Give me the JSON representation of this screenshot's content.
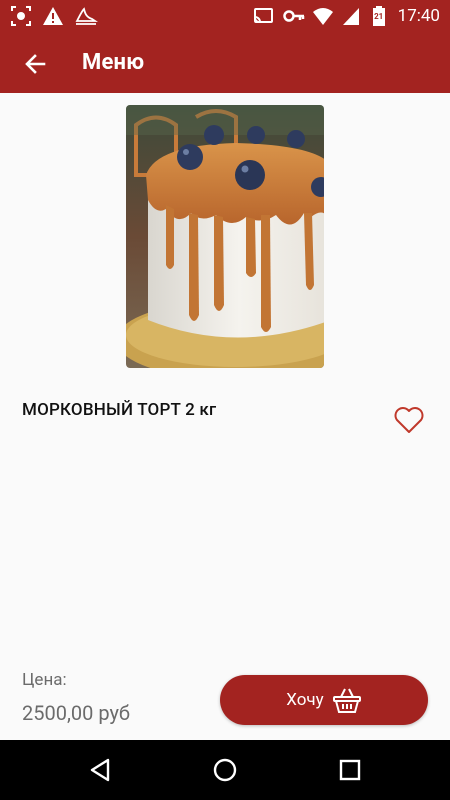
{
  "status_bar": {
    "time": "17:40",
    "battery_level_text": "21",
    "icons_left": [
      "screenshot-icon",
      "warning-icon",
      "notification-app-icon"
    ],
    "icons_right": [
      "cast-icon",
      "vpn-key-icon",
      "wifi-icon",
      "signal-icon",
      "battery-icon"
    ]
  },
  "app_bar": {
    "title": "Меню",
    "back_icon": "arrow-left-icon"
  },
  "product": {
    "name": "МОРКОВНЫЙ ТОРТ 2 кг",
    "image_subject": "cake-photo",
    "favorite_icon": "heart-outline-icon"
  },
  "price": {
    "label": "Цена:",
    "value": "2500,00 руб"
  },
  "buy_button": {
    "label": "Хочу",
    "icon": "basket-icon"
  },
  "nav_bar": {
    "icons": [
      "nav-back-icon",
      "nav-home-icon",
      "nav-recents-icon"
    ]
  },
  "colors": {
    "primary": "#a32320",
    "background": "#fafafa",
    "text_secondary": "#6b6b6b",
    "heart": "#c0392b"
  }
}
